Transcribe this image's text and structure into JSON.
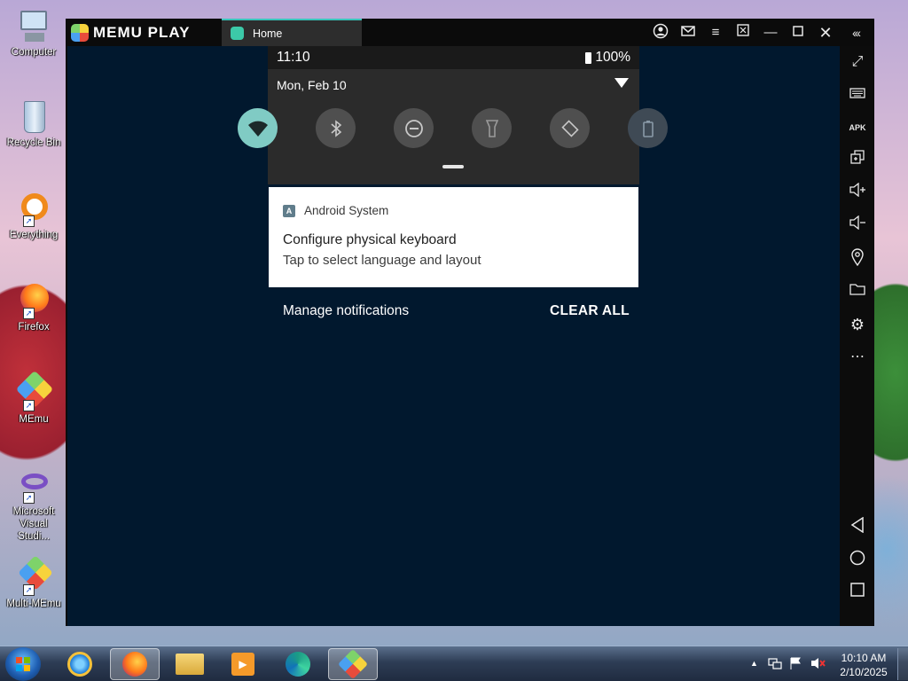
{
  "desktop": {
    "icons": [
      {
        "label": "Computer",
        "icon": "computer-icon"
      },
      {
        "label": "Recycle Bin",
        "icon": "recycle-bin-icon"
      },
      {
        "label": "Everything",
        "icon": "everything-icon"
      },
      {
        "label": "Firefox",
        "icon": "firefox-icon"
      },
      {
        "label": "MEmu",
        "icon": "memu-icon"
      },
      {
        "label": "Microsoft Visual Studi...",
        "icon": "visual-studio-icon"
      },
      {
        "label": "Multi-MEmu",
        "icon": "multi-memu-icon"
      }
    ]
  },
  "emulator": {
    "brand": "MEMU PLAY",
    "tab_label": "Home",
    "accent": "#39c5bb",
    "sidebar_tools": [
      "fullscreen-icon",
      "keyboard-icon",
      "apk-icon",
      "multi-window-icon",
      "volume-up-icon",
      "volume-down-icon",
      "location-icon",
      "folder-icon",
      "settings-icon",
      "more-icon",
      "back-icon",
      "home-icon",
      "recents-icon"
    ],
    "apk_label": "APK"
  },
  "android": {
    "status": {
      "time": "11:10",
      "battery": "100%"
    },
    "date": "Mon, Feb 10",
    "quick_settings": [
      "wifi",
      "bluetooth",
      "do-not-disturb",
      "flashlight",
      "auto-rotate",
      "battery-saver"
    ],
    "notification": {
      "app": "Android System",
      "title": "Configure physical keyboard",
      "text": "Tap to select language and layout"
    },
    "manage_label": "Manage notifications",
    "clear_label": "CLEAR ALL",
    "background": "#01182e",
    "qs_active_color": "#80cbc4"
  },
  "taskbar": {
    "apps": [
      "internet-explorer-icon",
      "firefox-icon",
      "file-explorer-icon",
      "media-player-icon",
      "edge-icon",
      "memu-icon"
    ],
    "clock_time": "10:10 AM",
    "clock_date": "2/10/2025"
  }
}
